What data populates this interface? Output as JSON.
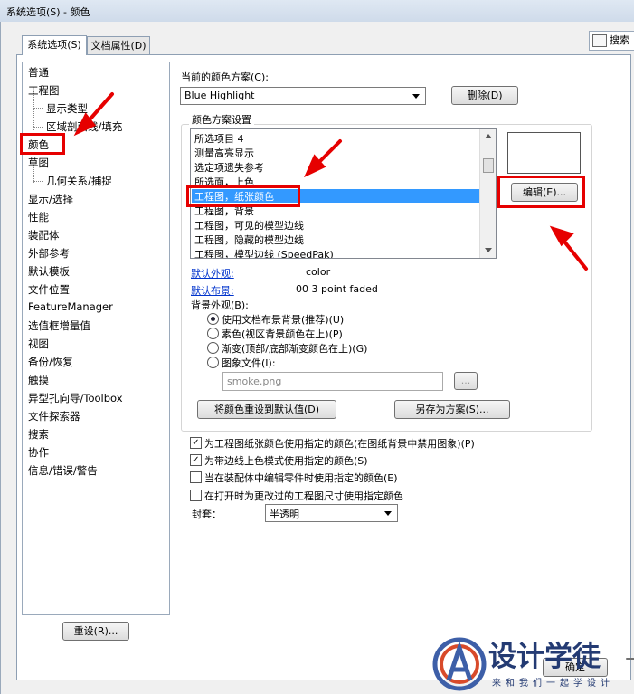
{
  "window": {
    "title": "系统选项(S) - 颜色"
  },
  "tabs": [
    "系统选项(S)",
    "文档属性(D)"
  ],
  "search": {
    "label": "搜索"
  },
  "sidebar": {
    "items": [
      "普通",
      "工程图",
      "显示类型",
      "区域剖面线/填充",
      "颜色",
      "草图",
      "几何关系/捕捉",
      "显示/选择",
      "性能",
      "装配体",
      "外部参考",
      "默认模板",
      "文件位置",
      "FeatureManager",
      "选值框增量值",
      "视图",
      "备份/恢复",
      "触摸",
      "异型孔向导/Toolbox",
      "文件探索器",
      "搜索",
      "协作",
      "信息/错误/警告"
    ]
  },
  "reset_button": "重设(R)...",
  "scheme_label": "当前的颜色方案(C):",
  "scheme_value": "Blue Highlight",
  "delete_button": "删除(D)",
  "group_title": "颜色方案设置",
  "color_list": [
    "所选项目 4",
    "测量高亮显示",
    "选定项遗失参考",
    "所选面，上色",
    "工程图，纸张颜色",
    "工程图，背景",
    "工程图，可见的模型边线",
    "工程图，隐藏的模型边线",
    "工程图，模型边线 (SpeedPak)"
  ],
  "edit_button": "编辑(E)...",
  "default_appearance_label": "默认外观:",
  "default_appearance_value": "color",
  "default_scene_label": "默认布景:",
  "default_scene_value": "00 3 point faded",
  "bg_label": "背景外观(B):",
  "bg_options": [
    "使用文档布景背景(推荐)(U)",
    "素色(视区背景颜色在上)(P)",
    "渐变(顶部/底部渐变颜色在上)(G)",
    "图象文件(I):"
  ],
  "image_file_value": "smoke.png",
  "browse_label": "...",
  "reset_colors_button": "将颜色重设到默认值(D)",
  "save_scheme_button": "另存为方案(S)...",
  "checkboxes": [
    {
      "label": "为工程图纸张颜色使用指定的颜色(在图纸背景中禁用图象)(P)",
      "checked": true
    },
    {
      "label": "为带边线上色模式使用指定的颜色(S)",
      "checked": true
    },
    {
      "label": "当在装配体中编辑零件时使用指定的颜色(E)",
      "checked": false
    },
    {
      "label": "在打开时为更改过的工程图尺寸使用指定颜色",
      "checked": false
    }
  ],
  "envelope_label": "封套：",
  "envelope_value": "半透明",
  "ok_button": "确定",
  "watermark": {
    "title": "设计学徒",
    "subtitle": "来和我们一起学设计"
  },
  "colors": {
    "highlight": "#3399ff",
    "annotation_red": "#e60000",
    "link": "#0033cc"
  }
}
